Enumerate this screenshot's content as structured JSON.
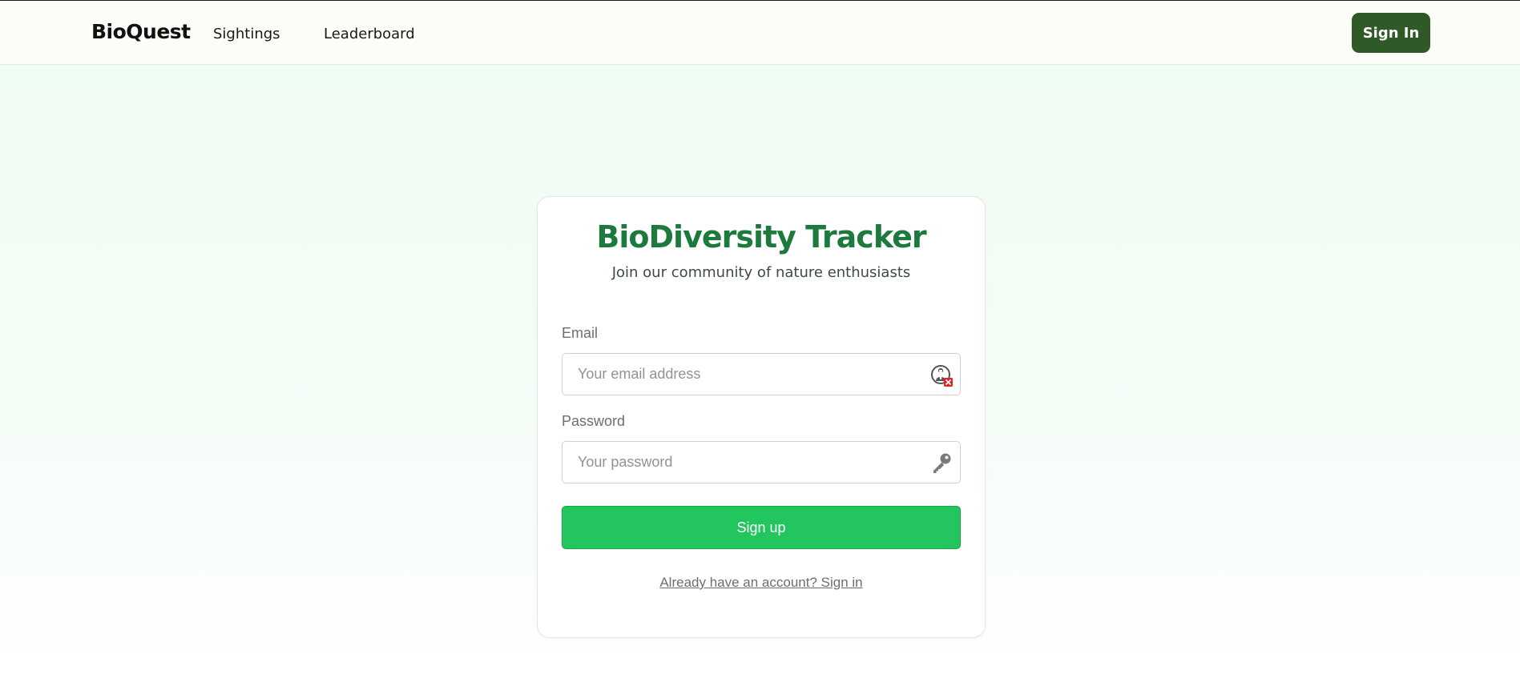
{
  "header": {
    "brand": "BioQuest",
    "nav": [
      {
        "label": "Sightings"
      },
      {
        "label": "Leaderboard"
      }
    ],
    "signin_label": "Sign In"
  },
  "card": {
    "title": "BioDiversity Tracker",
    "subtitle": "Join our community of nature enthusiasts",
    "email": {
      "label": "Email",
      "placeholder": "Your email address",
      "value": "",
      "icon": "password-manager-icon"
    },
    "password": {
      "label": "Password",
      "placeholder": "Your password",
      "value": "",
      "icon": "key-icon"
    },
    "submit_label": "Sign up",
    "alt_link": "Already have an account? Sign in"
  },
  "colors": {
    "brand_green": "#1c7a3c",
    "header_button": "#2f5a27",
    "submit_button": "#22c55e",
    "background_tint": "#eefcf2"
  }
}
